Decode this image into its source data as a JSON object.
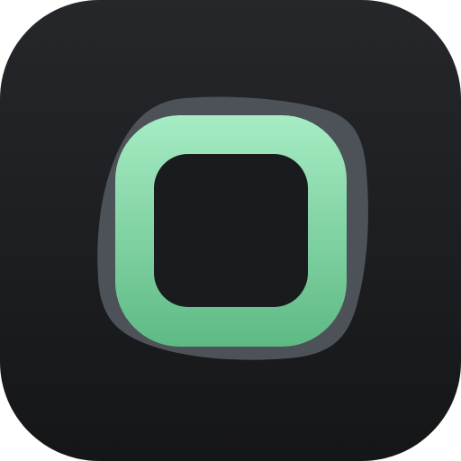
{
  "icon": {
    "name": "rounded-square-app-icon",
    "colors": {
      "background_top": "#25272b",
      "background_bottom": "#151618",
      "back_tile": "#4d5258",
      "ring_top": "#a6ecc4",
      "ring_bottom": "#5eba84",
      "inner": "#1a1b1e"
    }
  }
}
